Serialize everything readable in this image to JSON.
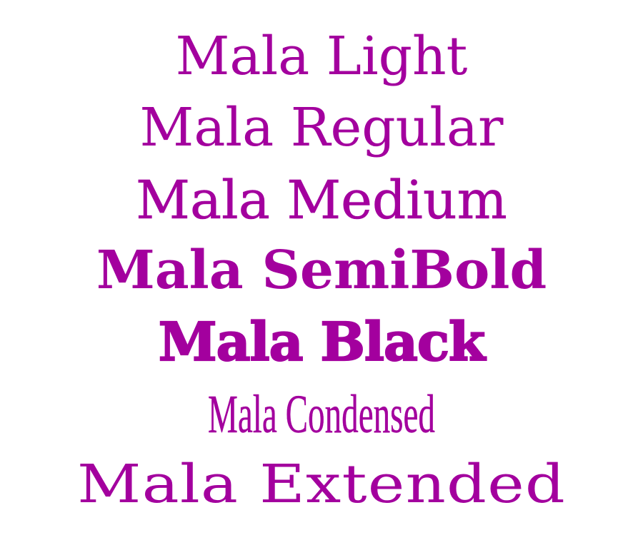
{
  "theme": {
    "text_color": "#a3009e",
    "background": "#ffffff"
  },
  "specimen": {
    "lines": [
      {
        "label": "Mala Light"
      },
      {
        "label": "Mala Regular"
      },
      {
        "label": "Mala Medium"
      },
      {
        "label": "Mala SemiBold"
      },
      {
        "label": "Mala Black"
      },
      {
        "label": "Mala Condensed"
      },
      {
        "label": "Mala Extended"
      }
    ]
  }
}
